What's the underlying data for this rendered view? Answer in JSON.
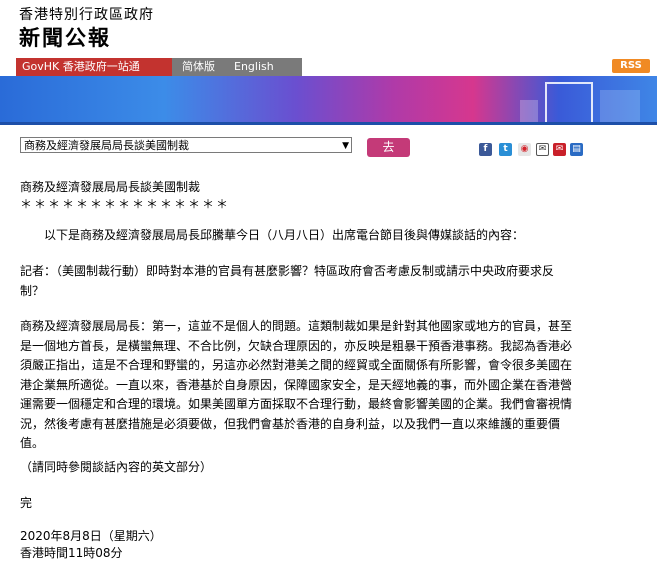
{
  "header": {
    "gov_title": "香港特別行政區政府",
    "press_title": "新聞公報"
  },
  "nav": {
    "govhk": "GovHK 香港政府一站通",
    "simplified": "简体版",
    "english": "English",
    "rss": "RSS"
  },
  "article_select": {
    "selected": "商務及經濟發展局局長談美國制裁"
  },
  "go_button": "去",
  "share_icons": [
    "facebook-icon",
    "twitter-icon",
    "weibo-icon",
    "email-icon",
    "print-icon"
  ],
  "article": {
    "title": "商務及經濟發展局局長談美國制裁",
    "stars": "＊＊＊＊＊＊＊＊＊＊＊＊＊＊＊",
    "intro": "以下是商務及經濟發展局局長邱騰華今日（八月八日）出席電台節目後與傳媒談話的內容：",
    "question_1": "記者：（美國制裁行動）即時對本港的官員有甚麼影響？特區政府會否考慮反制或請示中央政府要求反",
    "question_2": "制？",
    "answer_1": "商務及經濟發展局局長：第一，這並不是個人的問題。這類制裁如果是針對其他國家或地方的官員，甚至",
    "answer_2": "是一個地方首長，是橫蠻無理、不合比例，欠缺合理原因的，亦反映是粗暴干預香港事務。我認為香港必",
    "answer_3": "須嚴正指出，這是不合理和野蠻的，另這亦必然對港美之間的經貿或全面關係有所影響，會令很多美國在",
    "answer_4": "港企業無所適從。一直以來，香港基於自身原因，保障國家安全，是天經地義的事，而外國企業在香港營",
    "answer_5": "運需要一個穩定和合理的環境。如果美國單方面採取不合理行動，最終會影響美國的企業。我們會審視情",
    "answer_6": "況，然後考慮有甚麼措施是必須要做，但我們會基於香港的自身利益，以及我們一直以來維護的重要價",
    "answer_7": "值。",
    "note": "（請同時參閱談話內容的英文部分）",
    "end": "完",
    "date": "2020年8月8日（星期六）",
    "time": "香港時間11時08分"
  }
}
